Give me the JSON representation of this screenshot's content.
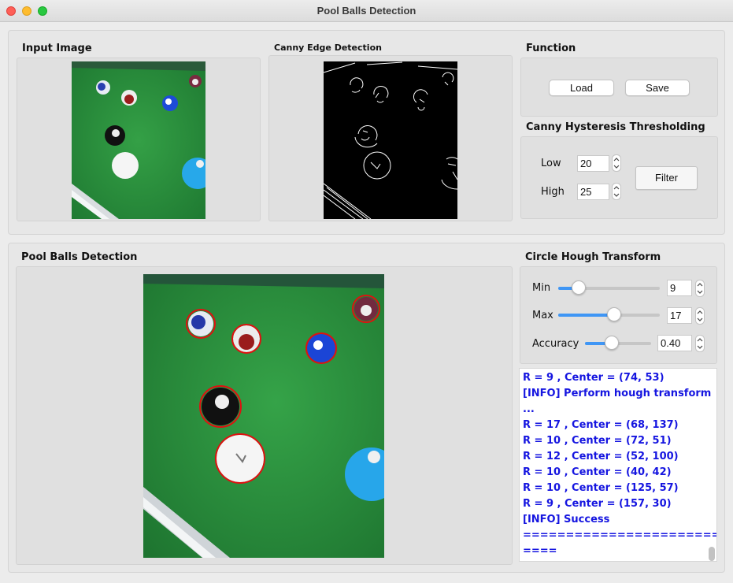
{
  "window": {
    "title": "Pool Balls Detection"
  },
  "input_panel": {
    "title": "Input Image"
  },
  "canny_panel": {
    "title": "Canny Edge Detection"
  },
  "function_panel": {
    "title": "Function",
    "load_label": "Load",
    "save_label": "Save"
  },
  "hysteresis": {
    "title": "Canny Hysteresis Thresholding",
    "low_label": "Low",
    "low_value": "20",
    "high_label": "High",
    "high_value": "25",
    "filter_label": "Filter"
  },
  "detection_panel": {
    "title": "Pool Balls Detection"
  },
  "hough": {
    "title": "Circle Hough Transform",
    "min_label": "Min",
    "min_value": "9",
    "min_level": 0.2,
    "max_label": "Max",
    "max_value": "17",
    "max_level": 0.55,
    "accuracy_label": "Accuracy",
    "accuracy_value": "0.40",
    "accuracy_level": 0.4
  },
  "log": [
    "R = 9 , Center = (74, 53)",
    "[INFO] Perform hough transform",
    "...",
    "R = 17 , Center = (68, 137)",
    "R = 10 , Center = (72, 51)",
    "R = 12 , Center = (52, 100)",
    "R = 10 , Center = (40, 42)",
    "R = 10 , Center = (125, 57)",
    "R = 9 , Center = (157, 30)",
    "[INFO] Success",
    "============================",
    "===="
  ],
  "colors": {
    "log_text": "#1515e0",
    "slider_fill": "#3f96f5",
    "felt": "#2f8f3f",
    "detection_circle": "#e01010"
  }
}
